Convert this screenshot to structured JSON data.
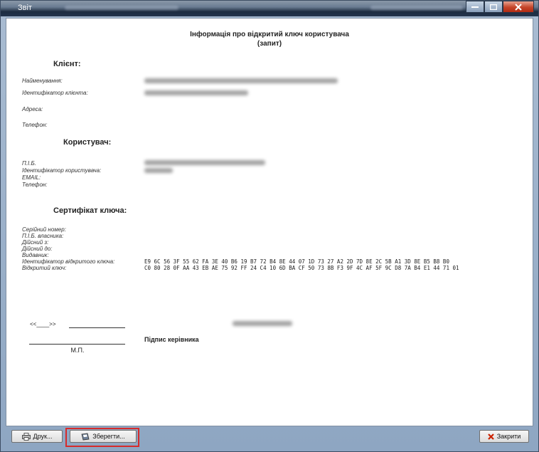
{
  "window": {
    "title": "Звіт"
  },
  "report": {
    "title": "Інформація про відкритий ключ користувача",
    "subtitle": "(запит)",
    "client": {
      "heading": "Клієнт:",
      "name_label": "Найменування:",
      "id_label": "Ідентифікатор клієнта:",
      "address_label": "Адреса:",
      "phone_label": "Телефон:"
    },
    "user": {
      "heading": "Користувач:",
      "fio_label": "П.І.Б.",
      "id_label": "Ідентифікатор користувача:",
      "email_label": "EMAIL:",
      "phone_label": "Телефон:"
    },
    "cert": {
      "heading": "Сертифікат ключа:",
      "serial_label": "Серійний номер:",
      "owner_label": "П.І.Б. власника:",
      "valid_from_label": "Дійсний з:",
      "valid_to_label": "Дійсний до:",
      "issuer_label": "Видавник:",
      "pubkey_id_label": "Ідентифікатор відкритого ключа:",
      "pubkey_label": "Відкритий ключ:",
      "pubkey_id_value": "E9 6C 56 3F 55 62 FA 3E 40 B6 19 B7 72 B4 8E 44 07 1D 73 27 A2 2D 7D 8E 2C 5B A1 3D 8E B5 B8 B0",
      "pubkey_value": "C0 80 28 0F AA 43 EB AE 75 92 FF 24 C4 10 6D BA CF 50 73 8B F3 9F 4C AF 5F 9C D8 7A B4 E1 44 71 01"
    },
    "signature": {
      "date_placeholder": "<<____>>",
      "stamp": "М.П.",
      "manager_sign": "Підпис керівника"
    }
  },
  "buttons": {
    "print": "Друк...",
    "save": "Зберегти...",
    "close": "Закрити"
  },
  "colors": {
    "highlight": "#d62b2b",
    "close_icon": "#cc2200"
  }
}
